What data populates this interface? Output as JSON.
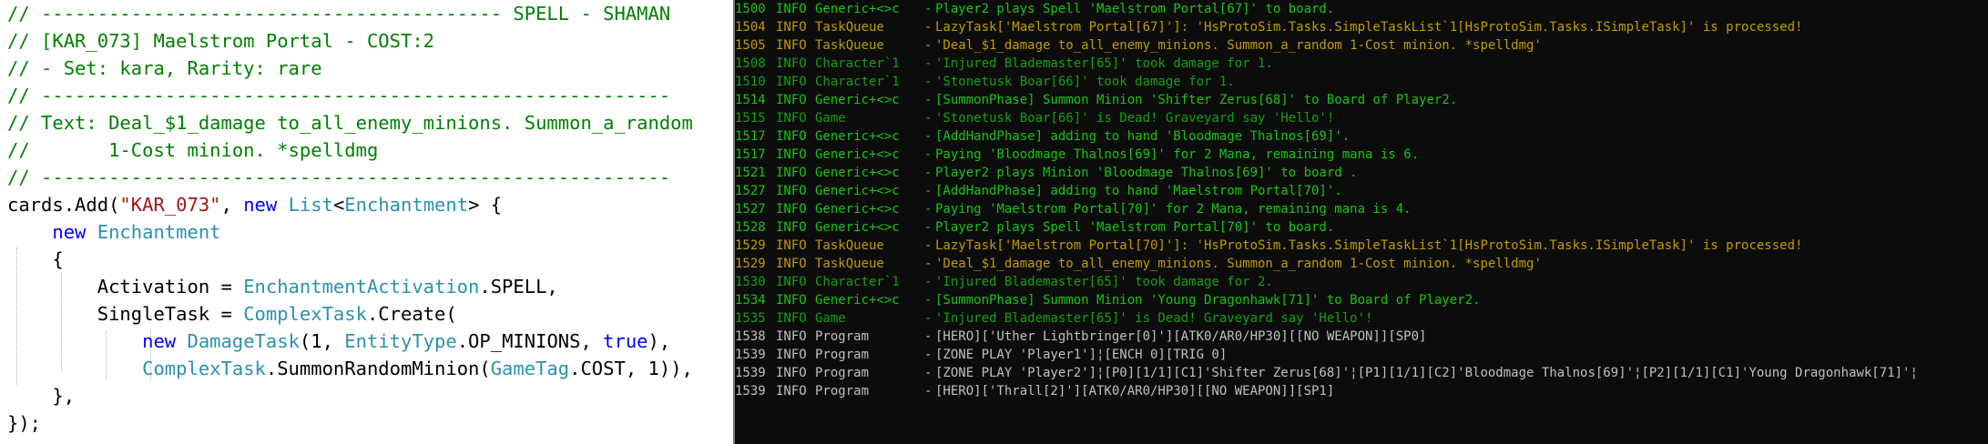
{
  "colors": {
    "code_bg": "#ffffff",
    "comment": "#008000",
    "string": "#a31515",
    "keyword": "#0000ff",
    "type": "#2b91af",
    "console_bg": "#0c0c0c",
    "console_default": "#c0c0c0",
    "log_green": "#16c60c",
    "log_olive": "#c19c00",
    "log_dark_green": "#13a10e"
  },
  "code": {
    "lines": [
      [
        {
          "t": "// ----------------------------------------- SPELL - SHAMAN",
          "c": "c"
        }
      ],
      [
        {
          "t": "// [KAR_073] Maelstrom Portal - COST:2",
          "c": "c"
        }
      ],
      [
        {
          "t": "// - Set: kara, Rarity: rare",
          "c": "c"
        }
      ],
      [
        {
          "t": "// --------------------------------------------------------",
          "c": "c"
        }
      ],
      [
        {
          "t": "// Text: Deal_$1_damage to_all_enemy_minions. Summon_a_random",
          "c": "c"
        }
      ],
      [
        {
          "t": "//       1-Cost minion. *spelldmg",
          "c": "c"
        }
      ],
      [
        {
          "t": "// --------------------------------------------------------",
          "c": "c"
        }
      ],
      [
        {
          "t": "cards.Add(",
          "c": "p"
        },
        {
          "t": "\"KAR_073\"",
          "c": "s"
        },
        {
          "t": ", ",
          "c": "p"
        },
        {
          "t": "new",
          "c": "k"
        },
        {
          "t": " ",
          "c": "p"
        },
        {
          "t": "List",
          "c": "t"
        },
        {
          "t": "<",
          "c": "p"
        },
        {
          "t": "Enchantment",
          "c": "t"
        },
        {
          "t": "> {",
          "c": "p"
        }
      ],
      [
        {
          "t": "    ",
          "c": "p"
        },
        {
          "t": "new",
          "c": "k"
        },
        {
          "t": " ",
          "c": "p"
        },
        {
          "t": "Enchantment",
          "c": "t"
        }
      ],
      [
        {
          "t": "    {",
          "c": "p"
        }
      ],
      [
        {
          "t": "        Activation = ",
          "c": "p"
        },
        {
          "t": "EnchantmentActivation",
          "c": "t"
        },
        {
          "t": ".SPELL,",
          "c": "p"
        }
      ],
      [
        {
          "t": "        SingleTask = ",
          "c": "p"
        },
        {
          "t": "ComplexTask",
          "c": "t"
        },
        {
          "t": ".Create(",
          "c": "p"
        }
      ],
      [
        {
          "t": "            ",
          "c": "p"
        },
        {
          "t": "new",
          "c": "k"
        },
        {
          "t": " ",
          "c": "p"
        },
        {
          "t": "DamageTask",
          "c": "t"
        },
        {
          "t": "(1, ",
          "c": "p"
        },
        {
          "t": "EntityType",
          "c": "t"
        },
        {
          "t": ".OP_MINIONS, ",
          "c": "p"
        },
        {
          "t": "true",
          "c": "k"
        },
        {
          "t": "),",
          "c": "p"
        }
      ],
      [
        {
          "t": "            ",
          "c": "p"
        },
        {
          "t": "ComplexTask",
          "c": "t"
        },
        {
          "t": ".SummonRandomMinion(",
          "c": "p"
        },
        {
          "t": "GameTag",
          "c": "t"
        },
        {
          "t": ".COST, 1)),",
          "c": "p"
        }
      ],
      [
        {
          "t": "    },",
          "c": "p"
        }
      ],
      [
        {
          "t": "});",
          "c": "p"
        }
      ]
    ]
  },
  "log": {
    "lines": [
      {
        "n": "1500",
        "l": "INFO",
        "s": "Generic+<>c",
        "m": "Player2 plays Spell 'Maelstrom Portal[67]' to board.",
        "c": "#16c60c"
      },
      {
        "n": "1504",
        "l": "INFO",
        "s": "TaskQueue",
        "m": "LazyTask['Maelstrom Portal[67]']: 'HsProtoSim.Tasks.SimpleTaskList`1[HsProtoSim.Tasks.ISimpleTask]' is processed!",
        "c": "#c19c00"
      },
      {
        "n": "1505",
        "l": "INFO",
        "s": "TaskQueue",
        "m": "'Deal_$1_damage to_all_enemy_minions. Summon_a_random 1-Cost minion. *spelldmg'",
        "c": "#c19c00"
      },
      {
        "n": "1508",
        "l": "INFO",
        "s": "Character`1",
        "m": "'Injured Blademaster[65]' took damage for 1.",
        "c": "#13a10e"
      },
      {
        "n": "1510",
        "l": "INFO",
        "s": "Character`1",
        "m": "'Stonetusk Boar[66]' took damage for 1.",
        "c": "#13a10e"
      },
      {
        "n": "1514",
        "l": "INFO",
        "s": "Generic+<>c",
        "m": "[SummonPhase] Summon Minion 'Shifter Zerus[68]' to Board of Player2.",
        "c": "#16c60c"
      },
      {
        "n": "1515",
        "l": "INFO",
        "s": "Game",
        "m": "'Stonetusk Boar[66]' is Dead! Graveyard say 'Hello'!",
        "c": "#13a10e"
      },
      {
        "n": "1517",
        "l": "INFO",
        "s": "Generic+<>c",
        "m": "[AddHandPhase] adding to hand 'Bloodmage Thalnos[69]'.",
        "c": "#16c60c"
      },
      {
        "n": "1517",
        "l": "INFO",
        "s": "Generic+<>c",
        "m": "Paying 'Bloodmage Thalnos[69]' for 2 Mana, remaining mana is 6.",
        "c": "#16c60c"
      },
      {
        "n": "1521",
        "l": "INFO",
        "s": "Generic+<>c",
        "m": "Player2 plays Minion 'Bloodmage Thalnos[69]' to board .",
        "c": "#16c60c"
      },
      {
        "n": "1527",
        "l": "INFO",
        "s": "Generic+<>c",
        "m": "[AddHandPhase] adding to hand 'Maelstrom Portal[70]'.",
        "c": "#16c60c"
      },
      {
        "n": "1527",
        "l": "INFO",
        "s": "Generic+<>c",
        "m": "Paying 'Maelstrom Portal[70]' for 2 Mana, remaining mana is 4.",
        "c": "#16c60c"
      },
      {
        "n": "1528",
        "l": "INFO",
        "s": "Generic+<>c",
        "m": "Player2 plays Spell 'Maelstrom Portal[70]' to board.",
        "c": "#16c60c"
      },
      {
        "n": "1529",
        "l": "INFO",
        "s": "TaskQueue",
        "m": "LazyTask['Maelstrom Portal[70]']: 'HsProtoSim.Tasks.SimpleTaskList`1[HsProtoSim.Tasks.ISimpleTask]' is processed!",
        "c": "#c19c00"
      },
      {
        "n": "1529",
        "l": "INFO",
        "s": "TaskQueue",
        "m": "'Deal_$1_damage to_all_enemy_minions. Summon_a_random 1-Cost minion. *spelldmg'",
        "c": "#c19c00"
      },
      {
        "n": "1530",
        "l": "INFO",
        "s": "Character`1",
        "m": "'Injured Blademaster[65]' took damage for 2.",
        "c": "#13a10e"
      },
      {
        "n": "1534",
        "l": "INFO",
        "s": "Generic+<>c",
        "m": "[SummonPhase] Summon Minion 'Young Dragonhawk[71]' to Board of Player2.",
        "c": "#16c60c"
      },
      {
        "n": "1535",
        "l": "INFO",
        "s": "Game",
        "m": "'Injured Blademaster[65]' is Dead! Graveyard say 'Hello'!",
        "c": "#13a10e"
      },
      {
        "n": "1538",
        "l": "INFO",
        "s": "Program",
        "m": "[HERO]['Uther Lightbringer[0]'][ATK0/AR0/HP30][[NO WEAPON]][SP0]",
        "c": "#c0c0c0"
      },
      {
        "n": "1539",
        "l": "INFO",
        "s": "Program",
        "m": "[ZONE PLAY 'Player1']¦[ENCH 0][TRIG 0]",
        "c": "#c0c0c0"
      },
      {
        "n": "1539",
        "l": "INFO",
        "s": "Program",
        "m": "[ZONE PLAY 'Player2']¦[P0][1/1][C1]'Shifter Zerus[68]'¦[P1][1/1][C2]'Bloodmage Thalnos[69]'¦[P2][1/1][C1]'Young Dragonhawk[71]'¦",
        "c": "#c0c0c0"
      },
      {
        "n": "1539",
        "l": "INFO",
        "s": "Program",
        "m": "[HERO]['Thrall[2]'][ATK0/AR0/HP30][[NO WEAPON]][SP1]",
        "c": "#c0c0c0"
      }
    ]
  }
}
